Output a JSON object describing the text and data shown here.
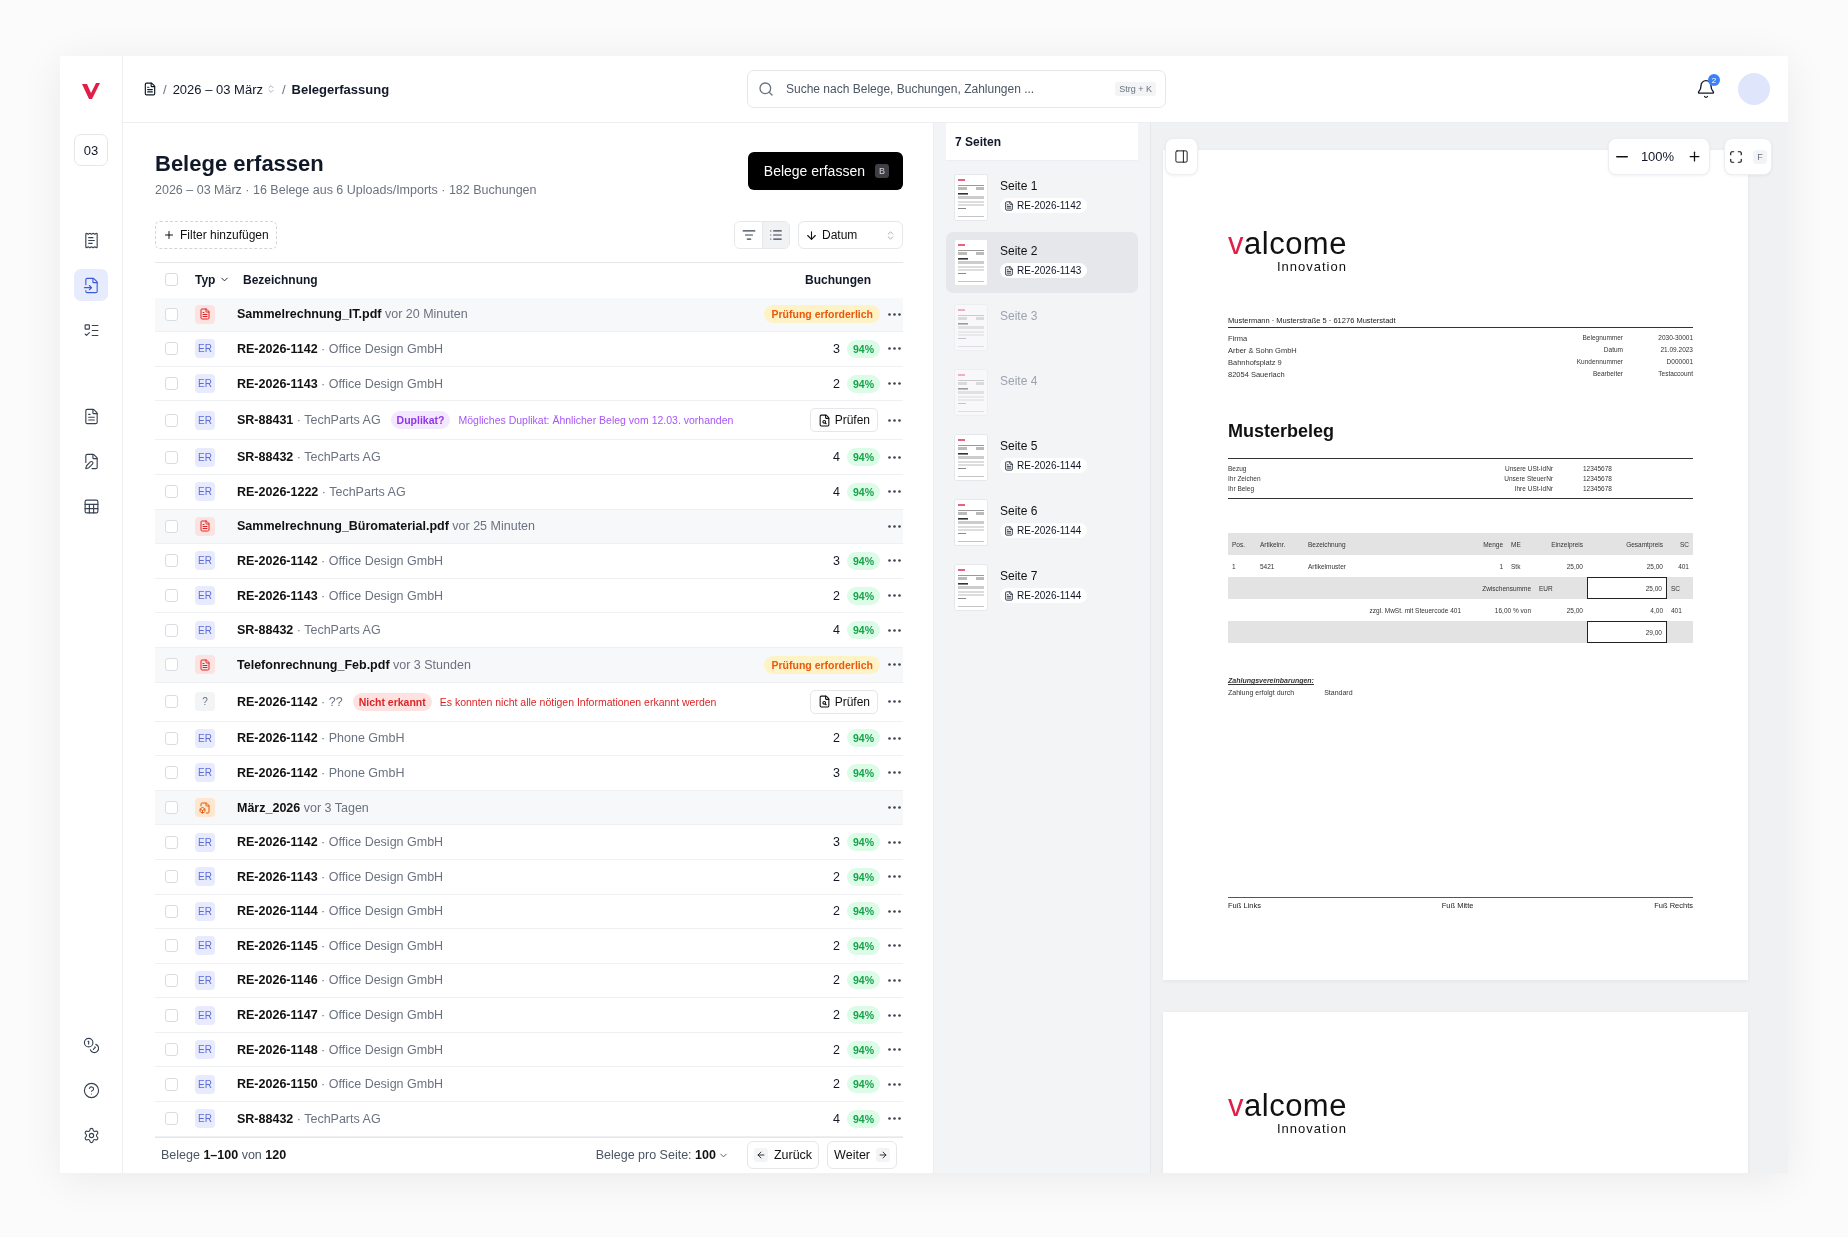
{
  "sidebar": {
    "workspace": "03",
    "nav_top": [
      {
        "selected": false
      },
      {
        "selected": true
      },
      {
        "selected": false
      }
    ],
    "nav_middle": [
      {
        "selected": false
      },
      {
        "selected": false
      },
      {
        "selected": false
      }
    ],
    "nav_bottom": [
      {
        "selected": false
      },
      {
        "selected": false
      },
      {
        "selected": false
      }
    ]
  },
  "breadcrumb": [
    {
      "kind": "period",
      "label": "2026 – 03 März",
      "separator": "/"
    },
    {
      "kind": "current",
      "label": "Belegerfassung",
      "separator": "/"
    }
  ],
  "search": {
    "placeholder": "Suche nach Belege, Buchungen, Zahlungen ...",
    "shortcut": "Strg + K"
  },
  "notifications": {
    "count": "2"
  },
  "header": {
    "title": "Belege erfassen",
    "subtitle": "2026 – 03 März · 16 Belege aus 6 Uploads/Imports · 182 Buchungen",
    "primary_button": {
      "label": "Belege erfassen",
      "shortcut": "B"
    }
  },
  "toolbar": {
    "filter_button": "Filter hinzufügen",
    "view_modes": [
      {
        "selected": false
      },
      {
        "selected": true
      }
    ],
    "sort": "Datum"
  },
  "table": {
    "select_all": {
      "checked": false
    },
    "columns": [
      "Typ",
      "Bezeichnung",
      "Buchungen"
    ],
    "rows": [
      {
        "kind": "file",
        "checked": false,
        "title": "**Sammelrechnung_IT.pdf** vor 20 Minuten",
        "status": "Prüfung erforderlich"
      },
      {
        "kind": "receipt",
        "checked": false,
        "badge": "ER",
        "title": "**RE-2026-1142** · Office Design GmbH",
        "count": "3",
        "confidence": "94%"
      },
      {
        "kind": "receipt",
        "checked": false,
        "badge": "ER",
        "title": "**RE-2026-1143** · Office Design GmbH",
        "count": "2",
        "confidence": "94%"
      },
      {
        "kind": "duplicate",
        "checked": false,
        "badge": "ER",
        "title": "**SR-88431** · TechParts AG",
        "tag": "Duplikat?",
        "message": "Mögliches Duplikat: Ähnlicher Beleg vom 12.03. vorhanden",
        "action": "Prüfen"
      },
      {
        "kind": "receipt",
        "checked": false,
        "badge": "ER",
        "title": "**SR-88432** · TechParts AG",
        "count": "4",
        "confidence": "94%"
      },
      {
        "kind": "receipt",
        "checked": false,
        "badge": "ER",
        "title": "**RE-2026-1222** · TechParts AG",
        "count": "4",
        "confidence": "94%"
      },
      {
        "kind": "file",
        "checked": false,
        "title": "**Sammelrechnung_Büromaterial.pdf** vor 25 Minuten"
      },
      {
        "kind": "receipt",
        "checked": false,
        "badge": "ER",
        "title": "**RE-2026-1142** · Office Design GmbH",
        "count": "3",
        "confidence": "94%"
      },
      {
        "kind": "receipt",
        "checked": false,
        "badge": "ER",
        "title": "**RE-2026-1143** · Office Design GmbH",
        "count": "2",
        "confidence": "94%"
      },
      {
        "kind": "receipt",
        "checked": false,
        "badge": "ER",
        "title": "**SR-88432** · TechParts AG",
        "count": "4",
        "confidence": "94%"
      },
      {
        "kind": "file",
        "checked": false,
        "title": "**Telefonrechnung_Feb.pdf** vor 3 Stunden",
        "status": "Prüfung erforderlich"
      },
      {
        "kind": "unrecognized",
        "checked": false,
        "badge": "?",
        "title": "**RE-2026-1142** · ??",
        "tag": "Nicht erkannt",
        "message": "Es konnten nicht alle nötigen Informationen erkannt werden",
        "action": "Prüfen"
      },
      {
        "kind": "receipt",
        "checked": false,
        "badge": "ER",
        "title": "**RE-2026-1142** · Phone GmbH",
        "count": "2",
        "confidence": "94%"
      },
      {
        "kind": "receipt",
        "checked": false,
        "badge": "ER",
        "title": "**RE-2026-1142** · Phone GmbH",
        "count": "3",
        "confidence": "94%"
      },
      {
        "kind": "import",
        "checked": false,
        "title": "**März_2026** vor 3 Tagen"
      },
      {
        "kind": "receipt",
        "checked": false,
        "badge": "ER",
        "title": "**RE-2026-1142** · Office Design GmbH",
        "count": "3",
        "confidence": "94%"
      },
      {
        "kind": "receipt",
        "checked": false,
        "badge": "ER",
        "title": "**RE-2026-1143** · Office Design GmbH",
        "count": "2",
        "confidence": "94%"
      },
      {
        "kind": "receipt",
        "checked": false,
        "badge": "ER",
        "title": "**RE-2026-1144** · Office Design GmbH",
        "count": "2",
        "confidence": "94%"
      },
      {
        "kind": "receipt",
        "checked": false,
        "badge": "ER",
        "title": "**RE-2026-1145** · Office Design GmbH",
        "count": "2",
        "confidence": "94%"
      },
      {
        "kind": "receipt",
        "checked": false,
        "badge": "ER",
        "title": "**RE-2026-1146** · Office Design GmbH",
        "count": "2",
        "confidence": "94%"
      },
      {
        "kind": "receipt",
        "checked": false,
        "badge": "ER",
        "title": "**RE-2026-1147** · Office Design GmbH",
        "count": "2",
        "confidence": "94%"
      },
      {
        "kind": "receipt",
        "checked": false,
        "badge": "ER",
        "title": "**RE-2026-1148** · Office Design GmbH",
        "count": "2",
        "confidence": "94%"
      },
      {
        "kind": "receipt",
        "checked": false,
        "badge": "ER",
        "title": "**RE-2026-1150** · Office Design GmbH",
        "count": "2",
        "confidence": "94%"
      },
      {
        "kind": "receipt",
        "checked": false,
        "badge": "ER",
        "title": "**SR-88432** · TechParts AG",
        "count": "4",
        "confidence": "94%"
      }
    ]
  },
  "pagination": {
    "range": "Belege **1–100** von **120**",
    "per_page": "Belege pro Seite: **100**",
    "previous": "Zurück",
    "next": "Weiter"
  },
  "pages": {
    "title": "7 Seiten",
    "items": [
      {
        "label": "Seite 1",
        "receipt": "RE-2026-1142",
        "selected": false,
        "dimmed": false
      },
      {
        "label": "Seite 2",
        "receipt": "RE-2026-1143",
        "selected": true,
        "dimmed": false
      },
      {
        "label": "Seite 3",
        "selected": false,
        "dimmed": true
      },
      {
        "label": "Seite 4",
        "selected": false,
        "dimmed": true
      },
      {
        "label": "Seite 5",
        "receipt": "RE-2026-1144",
        "selected": false,
        "dimmed": false
      },
      {
        "label": "Seite 6",
        "receipt": "RE-2026-1144",
        "selected": false,
        "dimmed": false
      },
      {
        "label": "Seite 7",
        "receipt": "RE-2026-1144",
        "selected": false,
        "dimmed": false
      }
    ]
  },
  "preview": {
    "zoom": "100%",
    "fullscreen_shortcut": "F",
    "document": {
      "logo": {
        "name": "valcome",
        "tagline": "Innovation"
      },
      "sender_line": "Mustermann · Musterstraße 5 · 61276 Musterstadt",
      "address": [
        "Firma",
        "Arber & Sohn GmbH",
        "Bahnhofsplatz 9",
        "82054 Sauerlach"
      ],
      "meta": [
        {
          "label": "Belegnummer",
          "value": "2030-30001"
        },
        {
          "label": "Datum",
          "value": "21.09.2023"
        },
        {
          "label": "Kundennummer",
          "value": "D000001"
        },
        {
          "label": "Bearbeiter",
          "value": "Testaccount"
        }
      ],
      "title": "Musterbeleg",
      "reference": [
        {
          "label": "Bezug",
          "field": "Unsere USt-IdNr",
          "value": "12345678"
        },
        {
          "label": "Ihr Zeichen",
          "field": "Unsere SteuerNr",
          "value": "12345678"
        },
        {
          "label": "Ihr Beleg",
          "field": "Ihre USt-IdNr",
          "value": "12345678"
        }
      ],
      "columns": [
        "Pos.",
        "Artikelnr.",
        "Bezeichnung",
        "Menge",
        "ME",
        "Einzelpreis",
        "Gesamtpreis",
        "SC"
      ],
      "items": [
        [
          "1",
          "5421",
          "Artikelmuster",
          "1",
          "Stk",
          "25,00",
          "25,00",
          "401"
        ]
      ],
      "subtotal": {
        "label": "Zwischensumme",
        "currency": "EUR",
        "value": "25,00",
        "code": "SC"
      },
      "tax": {
        "label": "zzgl. MwSt. mit Steuercode 401",
        "rate": "16,00 % von",
        "base": "25,00",
        "value": "4,00",
        "code": "401"
      },
      "total": "29,00",
      "payment": {
        "heading": "Zahlungsvereinbarungen:",
        "label": "Zahlung erfolgt durch",
        "value": "Standard"
      },
      "footer": [
        "Fuß Links",
        "Fuß Mitte",
        "Fuß Rechts"
      ]
    },
    "next_page": {
      "logo": {
        "name": "valcome",
        "tagline": "Innovation"
      }
    }
  }
}
